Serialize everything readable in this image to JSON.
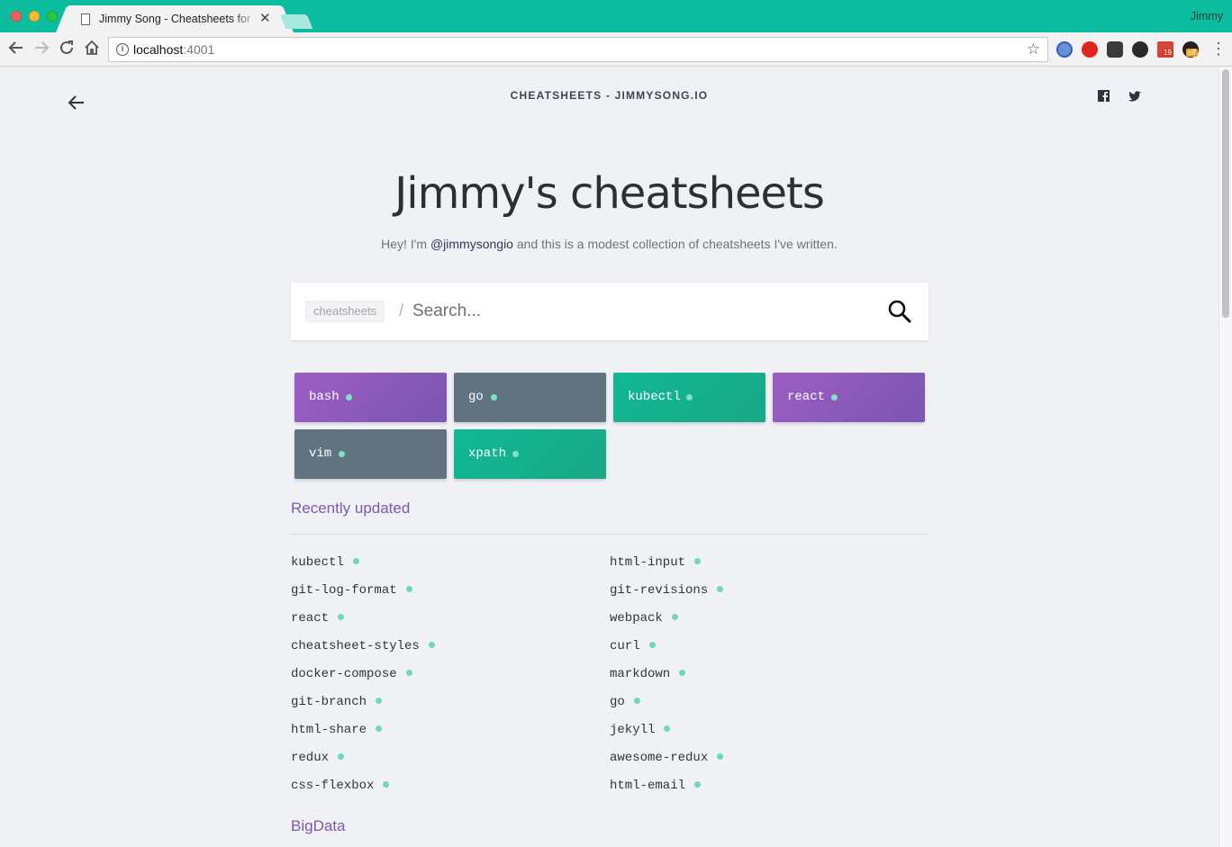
{
  "browser": {
    "tab_title": "Jimmy Song - Cheatsheets for",
    "profile": "Jimmy",
    "url_host": "localhost",
    "url_port": ":4001",
    "extension_badges": [
      "19",
      "off"
    ]
  },
  "header": {
    "site_title": "CHEATSHEETS - JIMMYSONG.IO"
  },
  "hero": {
    "title": "Jimmy's cheatsheets",
    "sub_before": "Hey! I'm ",
    "handle": "@jimmysongio",
    "sub_after": " and this is a modest collection of cheatsheets I've written."
  },
  "search": {
    "tag": "cheatsheets",
    "slash": "/",
    "placeholder": "Search..."
  },
  "featured": [
    {
      "label": "bash",
      "color": "purple"
    },
    {
      "label": "go",
      "color": "slate"
    },
    {
      "label": "kubectl",
      "color": "teal"
    },
    {
      "label": "react",
      "color": "purple"
    },
    {
      "label": "vim",
      "color": "slate"
    },
    {
      "label": "xpath",
      "color": "teal"
    }
  ],
  "recently_updated": {
    "heading": "Recently updated",
    "left": [
      "kubectl",
      "git-log-format",
      "react",
      "cheatsheet-styles",
      "docker-compose",
      "git-branch",
      "html-share",
      "redux",
      "css-flexbox"
    ],
    "right": [
      "html-input",
      "git-revisions",
      "webpack",
      "curl",
      "markdown",
      "go",
      "jekyll",
      "awesome-redux",
      "html-email"
    ]
  },
  "next_section": {
    "heading": "BigData"
  },
  "colors": {
    "chrome": "#0bbc9f",
    "accent": "#7a58b8",
    "dot": "#6ed9b3"
  }
}
